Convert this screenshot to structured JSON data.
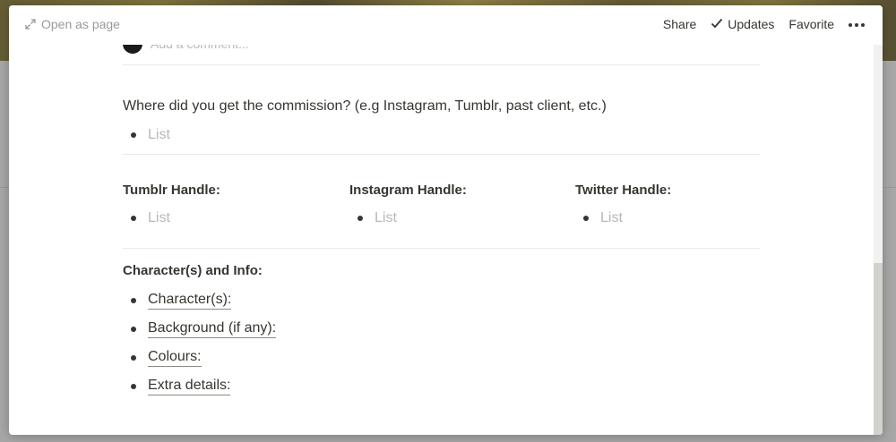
{
  "topbar": {
    "open_as_page": "Open as page",
    "share": "Share",
    "updates": "Updates",
    "favorite": "Favorite"
  },
  "comment": {
    "placeholder": "Add a comment..."
  },
  "question": {
    "text": "Where did you get the commission? (e.g Instagram, Tumblr, past client, etc.)",
    "list_placeholder": "List"
  },
  "handles": [
    {
      "label": "Tumblr Handle:",
      "placeholder": "List"
    },
    {
      "label": "Instagram Handle:",
      "placeholder": "List"
    },
    {
      "label": "Twitter Handle:",
      "placeholder": "List"
    }
  ],
  "character_info": {
    "heading": "Character(s) and Info:",
    "items": [
      "Character(s):",
      "Background (if any):",
      "Colours:",
      "Extra details:"
    ]
  }
}
